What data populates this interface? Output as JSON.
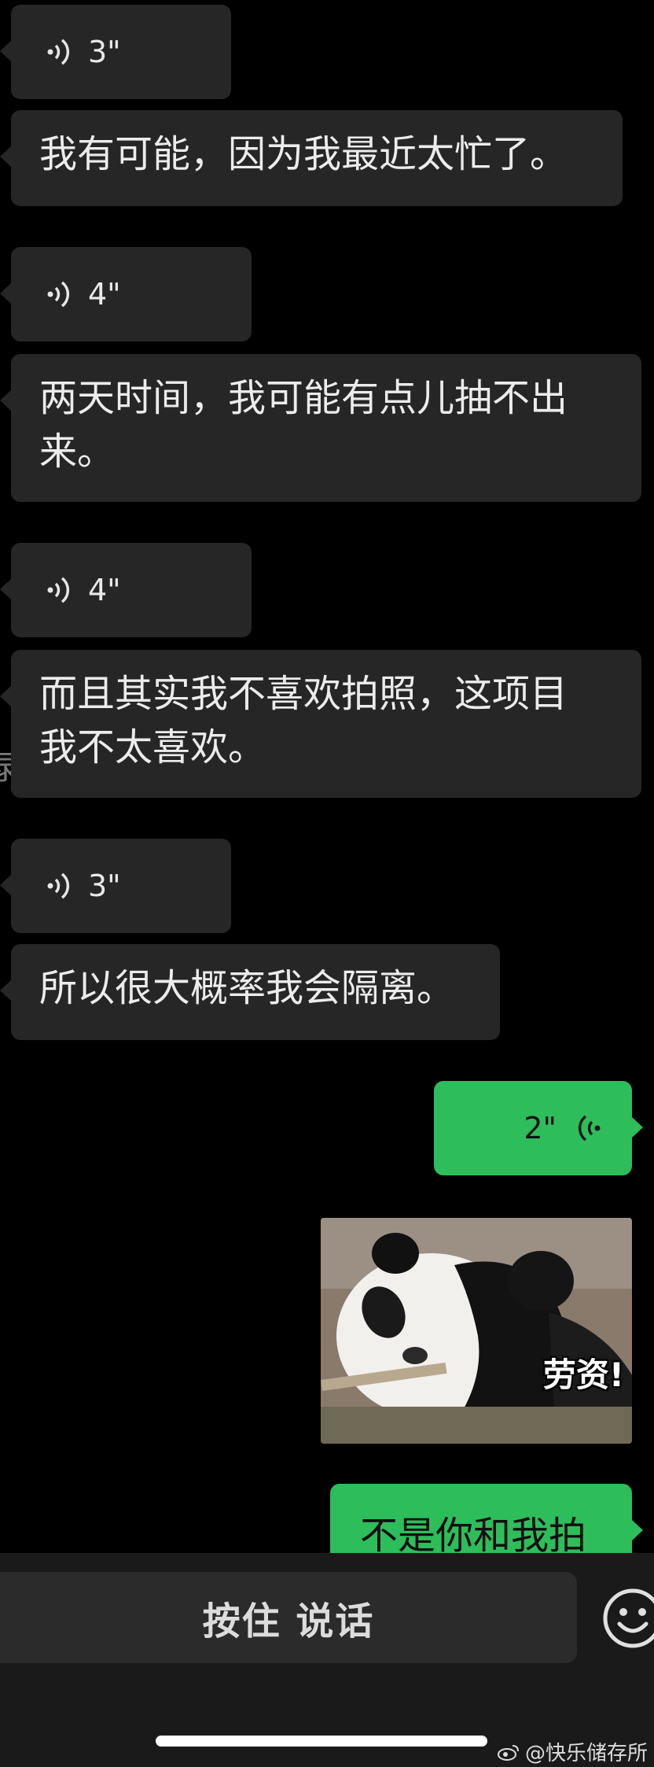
{
  "messages": [
    {
      "type": "voice",
      "dir": "in",
      "duration": "3\""
    },
    {
      "type": "text",
      "dir": "in",
      "text": "我有可能，因为我最近太忙了。"
    },
    {
      "type": "voice",
      "dir": "in",
      "duration": "4\""
    },
    {
      "type": "text",
      "dir": "in",
      "line1": "两天时间，我可能有点儿抽不出",
      "line2": "来。"
    },
    {
      "type": "voice",
      "dir": "in",
      "duration": "4\""
    },
    {
      "type": "text",
      "dir": "in",
      "line1": "而且其实我不喜欢拍照，这项目",
      "line2": "我不太喜欢。"
    },
    {
      "type": "voice",
      "dir": "in",
      "duration": "3\""
    },
    {
      "type": "text",
      "dir": "in",
      "text": "所以很大概率我会隔离。"
    },
    {
      "type": "voice",
      "dir": "out",
      "duration": "2\""
    },
    {
      "type": "sticker",
      "dir": "out",
      "caption": "劳资!"
    },
    {
      "type": "text",
      "dir": "out",
      "text": "不是你和我拍"
    }
  ],
  "edge_char": "录",
  "input_bar": {
    "hold_to_talk_label": "按住 说话"
  },
  "watermark": {
    "text": "@快乐储存所"
  },
  "colors": {
    "incoming": "#262626",
    "outgoing": "#2ebd5b",
    "background": "#000000"
  }
}
